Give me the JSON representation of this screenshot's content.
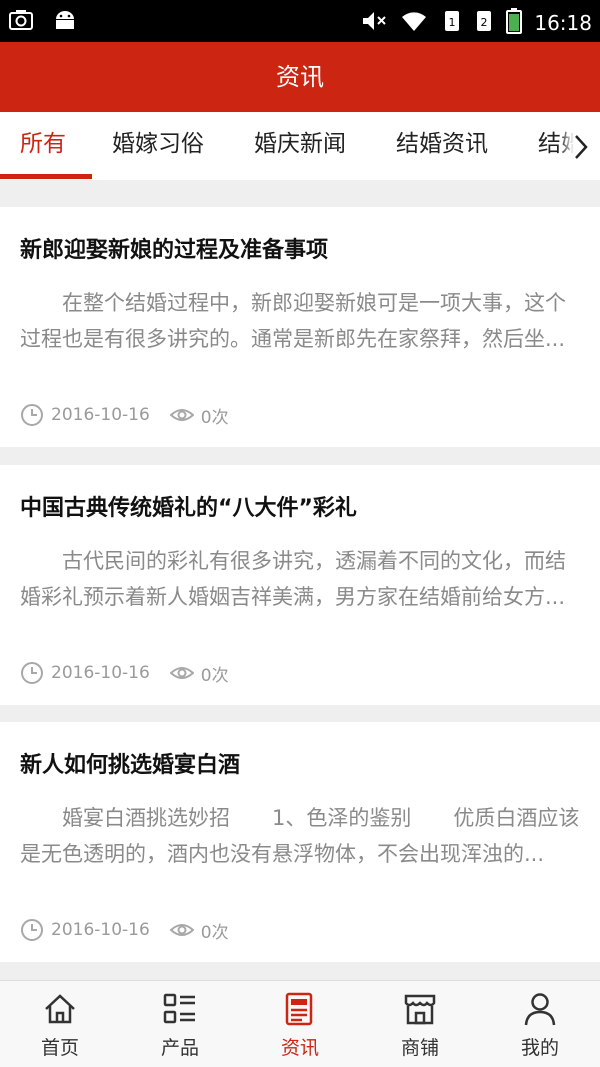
{
  "status_bar": {
    "time": "16:18",
    "icons": [
      "screenshot-icon",
      "android-icon",
      "mute-icon",
      "wifi-icon",
      "sim1-icon",
      "sim2-icon",
      "battery-icon"
    ]
  },
  "header": {
    "title": "资讯"
  },
  "tabs": [
    {
      "label": "所有",
      "active": true
    },
    {
      "label": "婚嫁习俗",
      "active": false
    },
    {
      "label": "婚庆新闻",
      "active": false
    },
    {
      "label": "结婚资讯",
      "active": false
    },
    {
      "label": "结婚",
      "active": false
    }
  ],
  "articles": [
    {
      "title": "新郎迎娶新娘的过程及准备事项",
      "summary": "在整个结婚过程中，新郎迎娶新娘可是一项大事，这个过程也是有很多讲究的。通常是新郎先在家祭拜，然后坐...",
      "date": "2016-10-16",
      "views": "0次"
    },
    {
      "title": "中国古典传统婚礼的“八大件”彩礼",
      "summary": "古代民间的彩礼有很多讲究，透漏着不同的文化，而结婚彩礼预示着新人婚姻吉祥美满，男方家在结婚前给女方...",
      "date": "2016-10-16",
      "views": "0次"
    },
    {
      "title": "新人如何挑选婚宴白酒",
      "summary": "婚宴白酒挑选妙招　　1、色泽的鉴别　　优质白酒应该是无色透明的，酒内也没有悬浮物体，不会出现浑浊的...",
      "date": "2016-10-16",
      "views": "0次"
    }
  ],
  "bottom_nav": [
    {
      "label": "首页",
      "icon": "home-icon",
      "active": false
    },
    {
      "label": "产品",
      "icon": "product-list-icon",
      "active": false
    },
    {
      "label": "资讯",
      "icon": "news-icon",
      "active": true
    },
    {
      "label": "商铺",
      "icon": "shop-icon",
      "active": false
    },
    {
      "label": "我的",
      "icon": "user-icon",
      "active": false
    }
  ],
  "colors": {
    "brand": "#cc2613",
    "active_tab": "#cc2613",
    "text_muted": "#8a8a8a"
  }
}
